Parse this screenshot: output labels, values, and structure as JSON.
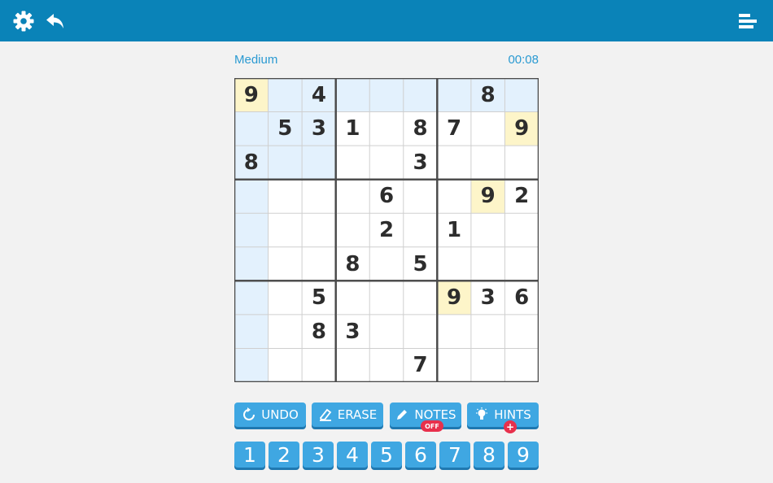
{
  "header": {
    "settings_icon": "gear-icon",
    "undo_icon": "undo-arrow-icon",
    "menu_icon": "bar-menu-icon",
    "color": "#0a83b8"
  },
  "game": {
    "difficulty": "Medium",
    "timer": "00:08"
  },
  "board": {
    "grid": [
      [
        "9",
        "",
        "4",
        "",
        "",
        "",
        "",
        "8",
        ""
      ],
      [
        "",
        "5",
        "3",
        "1",
        "",
        "8",
        "7",
        "",
        "9"
      ],
      [
        "8",
        "",
        "",
        "",
        "",
        "3",
        "",
        "",
        ""
      ],
      [
        "",
        "",
        "",
        "",
        "6",
        "",
        "",
        "9",
        "2"
      ],
      [
        "",
        "",
        "",
        "",
        "2",
        "",
        "1",
        "",
        ""
      ],
      [
        "",
        "",
        "",
        "8",
        "",
        "5",
        "",
        "",
        ""
      ],
      [
        "",
        "",
        "5",
        "",
        "",
        "",
        "9",
        "3",
        "6"
      ],
      [
        "",
        "",
        "8",
        "3",
        "",
        "",
        "",
        "",
        ""
      ],
      [
        "",
        "",
        "",
        "",
        "",
        "7",
        "",
        "",
        ""
      ]
    ],
    "selected": [
      0,
      0
    ],
    "highlight_color": "#e3f1fd",
    "same_number_color": "#fdf5c9"
  },
  "actions": {
    "undo": "UNDO",
    "erase": "ERASE",
    "notes": "NOTES",
    "notes_state": "OFF",
    "hints": "HINTS",
    "hints_badge": "+"
  },
  "numpad": [
    "1",
    "2",
    "3",
    "4",
    "5",
    "6",
    "7",
    "8",
    "9"
  ],
  "colors": {
    "button": "#3fa7e2",
    "button_shadow": "#1f78b0",
    "badge": "#e8304c",
    "accent_text": "#2a9ad2"
  }
}
